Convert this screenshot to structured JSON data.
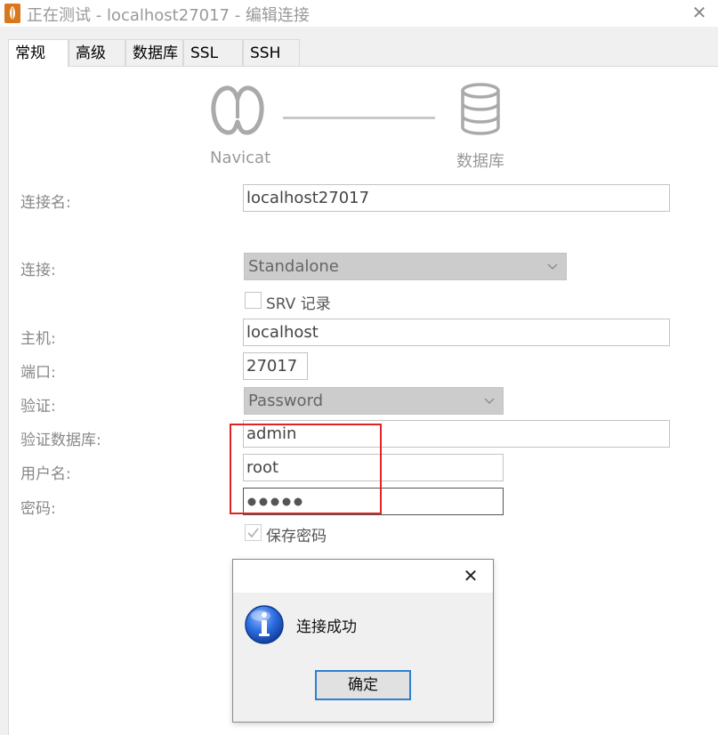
{
  "window": {
    "title": "正在测试 - localhost27017 - 编辑连接",
    "close_glyph": "✕",
    "icon": "mongodb-leaf-icon"
  },
  "tabs": [
    {
      "label": "常规",
      "active": true
    },
    {
      "label": "高级",
      "active": false
    },
    {
      "label": "数据库",
      "active": false
    },
    {
      "label": "SSL",
      "active": false
    },
    {
      "label": "SSH",
      "active": false
    }
  ],
  "diagram": {
    "left_label": "Navicat",
    "right_label": "数据库",
    "left_icon": "navicat-logo-icon",
    "right_icon": "database-icon"
  },
  "form": {
    "connection_name_label": "连接名:",
    "connection_name_value": "localhost27017",
    "connection_type_label": "连接:",
    "connection_type_value": "Standalone",
    "srv_label": "SRV 记录",
    "srv_checked": false,
    "host_label": "主机:",
    "host_value": "localhost",
    "port_label": "端口:",
    "port_value": "27017",
    "auth_label": "验证:",
    "auth_value": "Password",
    "auth_db_label": "验证数据库:",
    "auth_db_value": "admin",
    "username_label": "用户名:",
    "username_value": "root",
    "password_label": "密码:",
    "password_dot_count": 5,
    "save_password_label": "保存密码",
    "save_password_checked": true
  },
  "dialog": {
    "message": "连接成功",
    "ok_label": "确定",
    "close_glyph": "✕",
    "icon": "info-icon"
  },
  "colors": {
    "highlight_border": "#e02424",
    "button_focus": "#2f7fd2",
    "info_blue": "#1d57c9"
  }
}
